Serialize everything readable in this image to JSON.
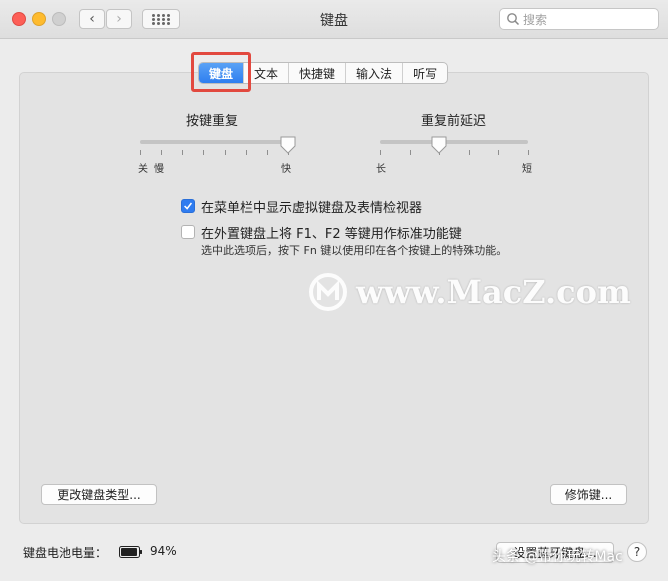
{
  "window": {
    "title": "键盘",
    "search_placeholder": "搜索"
  },
  "tabs": [
    {
      "label": "键盘",
      "active": true
    },
    {
      "label": "文本",
      "active": false
    },
    {
      "label": "快捷键",
      "active": false
    },
    {
      "label": "输入法",
      "active": false
    },
    {
      "label": "听写",
      "active": false
    }
  ],
  "key_repeat": {
    "label": "按键重复",
    "left_labels": [
      "关",
      "慢"
    ],
    "right_label": "快",
    "value_fraction": 1.0
  },
  "repeat_delay": {
    "label": "重复前延迟",
    "left_label": "长",
    "right_label": "短",
    "value_fraction": 0.4
  },
  "options": {
    "show_viewer": {
      "label": "在菜单栏中显示虚拟键盘及表情检视器",
      "checked": true
    },
    "fn_keys": {
      "label": "在外置键盘上将 F1、F2 等键用作标准功能键",
      "checked": false
    },
    "fn_hint": "选中此选项后，按下 Fn 键以使用印在各个按键上的特殊功能。"
  },
  "buttons": {
    "change_keyboard_type": "更改键盘类型...",
    "modifier_keys": "修饰键...",
    "setup_bluetooth": "设置蓝牙键盘..."
  },
  "battery": {
    "label": "键盘电池电量：",
    "percent": "94%",
    "level": 0.94
  },
  "overlays": {
    "watermark": "www.MacZ.com",
    "credit": "头条 @带你玩转Mac"
  },
  "colors": {
    "accent": "#2f7cf0",
    "highlight": "#e2493f"
  }
}
